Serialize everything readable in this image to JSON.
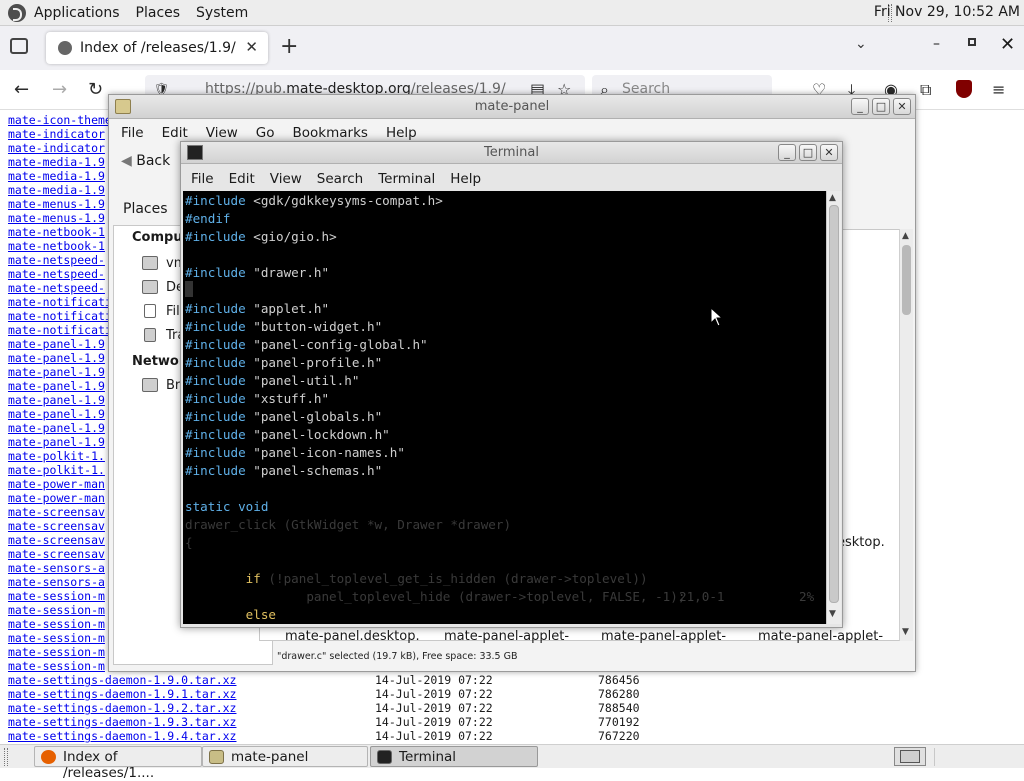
{
  "top_panel": {
    "menus": [
      "Applications",
      "Places",
      "System"
    ],
    "clock": "Fri Nov 29, 10:52 AM"
  },
  "firefox": {
    "tab_title": "Index of /releases/1.9/",
    "url_prefix": "https://pub.",
    "url_domain": "mate-desktop.org",
    "url_path": "/releases/1.9/",
    "search_placeholder": "Search"
  },
  "listing": {
    "left_links": [
      "mate-icon-theme",
      "mate-indicator",
      "mate-indicator",
      "mate-media-1.9",
      "mate-media-1.9",
      "mate-media-1.9",
      "mate-menus-1.9",
      "mate-menus-1.9",
      "mate-netbook-1",
      "mate-netbook-1",
      "mate-netspeed-",
      "mate-netspeed-",
      "mate-netspeed-",
      "mate-notificati",
      "mate-notificati",
      "mate-notificati",
      "mate-panel-1.9",
      "mate-panel-1.9",
      "mate-panel-1.9",
      "mate-panel-1.9",
      "mate-panel-1.9",
      "mate-panel-1.9",
      "mate-panel-1.9",
      "mate-panel-1.9",
      "mate-polkit-1.",
      "mate-polkit-1.",
      "mate-power-man",
      "mate-power-man",
      "mate-screensav",
      "mate-screensav",
      "mate-screensav",
      "mate-screensav",
      "mate-sensors-a",
      "mate-sensors-a",
      "mate-session-m",
      "mate-session-m",
      "mate-session-m",
      "mate-session-m",
      "mate-session-m",
      "mate-session-m"
    ],
    "full_rows": [
      {
        "name": "mate-settings-daemon-1.9.0.tar.xz",
        "date": "14-Jul-2019 07:22",
        "size": "786456"
      },
      {
        "name": "mate-settings-daemon-1.9.1.tar.xz",
        "date": "14-Jul-2019 07:22",
        "size": "786280"
      },
      {
        "name": "mate-settings-daemon-1.9.2.tar.xz",
        "date": "14-Jul-2019 07:22",
        "size": "788540"
      },
      {
        "name": "mate-settings-daemon-1.9.3.tar.xz",
        "date": "14-Jul-2019 07:22",
        "size": "770192"
      },
      {
        "name": "mate-settings-daemon-1.9.4.tar.xz",
        "date": "14-Jul-2019 07:22",
        "size": "767220"
      }
    ]
  },
  "caja": {
    "title": "mate-panel",
    "menu": [
      "File",
      "Edit",
      "View",
      "Go",
      "Bookmarks",
      "Help"
    ],
    "back_label": "Back",
    "places_label": "Places",
    "computer_heading": "Comput",
    "network_heading": "Networ",
    "side_items": [
      "vm",
      "De",
      "Fil",
      "Tra"
    ],
    "network_item": "Br",
    "file_labels": [
      "mate-panel.desktop.",
      "mate-panel-applet-",
      "mate-panel-applet-",
      "mate-panel-applet-"
    ],
    "desktop_label": "esktop.",
    "status": "\"drawer.c\" selected (19.7 kB), Free space: 33.5 GB"
  },
  "terminal": {
    "title": "Terminal",
    "menu": [
      "File",
      "Edit",
      "View",
      "Search",
      "Terminal",
      "Help"
    ],
    "lines": [
      {
        "kw": "#include",
        "rest": " <gdk/gdkkeysyms-compat.h>"
      },
      {
        "kw": "#endif",
        "rest": ""
      },
      {
        "kw": "#include",
        "rest": " <gio/gio.h>"
      },
      {
        "kw": "",
        "rest": ""
      },
      {
        "kw": "#include",
        "rest": " \"drawer.h\""
      },
      {
        "kw": "",
        "rest": ""
      },
      {
        "kw": "#include",
        "rest": " \"applet.h\""
      },
      {
        "kw": "#include",
        "rest": " \"button-widget.h\""
      },
      {
        "kw": "#include",
        "rest": " \"panel-config-global.h\""
      },
      {
        "kw": "#include",
        "rest": " \"panel-profile.h\""
      },
      {
        "kw": "#include",
        "rest": " \"panel-util.h\""
      },
      {
        "kw": "#include",
        "rest": " \"xstuff.h\""
      },
      {
        "kw": "#include",
        "rest": " \"panel-globals.h\""
      },
      {
        "kw": "#include",
        "rest": " \"panel-lockdown.h\""
      },
      {
        "kw": "#include",
        "rest": " \"panel-icon-names.h\""
      },
      {
        "kw": "#include",
        "rest": " \"panel-schemas.h\""
      },
      {
        "kw": "",
        "rest": ""
      },
      {
        "kw": "static void",
        "rest": ""
      }
    ],
    "dim_lines": [
      "drawer_click (GtkWidget *w, Drawer *drawer)",
      "{",
      "",
      "        if (!panel_toplevel_get_is_hidden (drawer->toplevel))",
      "                panel_toplevel_hide (drawer->toplevel, FALSE, -1);",
      "        else"
    ],
    "status_pos": "21,0-1",
    "status_pct": "2%"
  },
  "taskbar": {
    "tasks": [
      "Index of /releases/1....",
      "mate-panel",
      "Terminal"
    ]
  }
}
